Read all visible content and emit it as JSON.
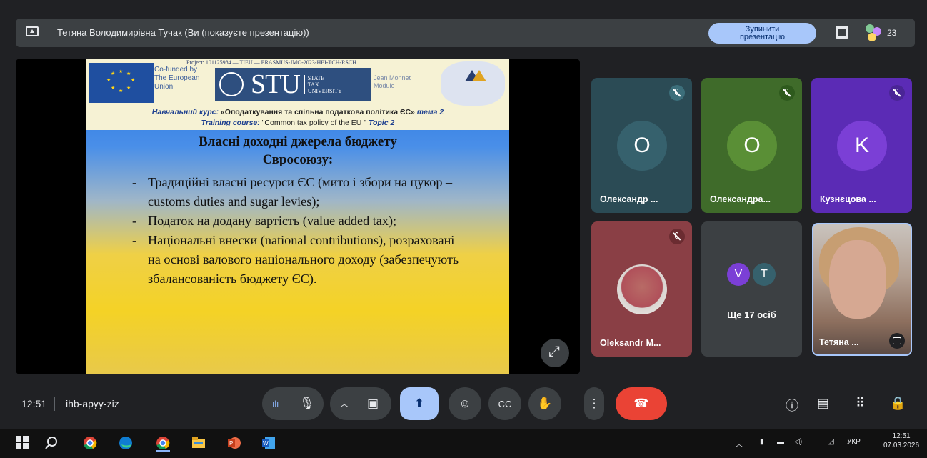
{
  "topbar": {
    "title": "Тетяна Володимирівна Тучак (Ви (показуєте презентацію))",
    "stop_button": "Зупинити презентацію",
    "participants_count": "23"
  },
  "slide": {
    "project_line": "Project: 101125984 — TIEU — ERASMUS-JMO-2023-HEI-TCH-RSCH",
    "cofunded": [
      "Co-funded by",
      "The European",
      "Union"
    ],
    "stu_letters": "STU",
    "stu_sub": [
      "STATE",
      "TAX",
      "UNIVERSITY"
    ],
    "jean": [
      "Jean Monnet",
      "Module"
    ],
    "course_ua_prefix": "Навчальний курс: ",
    "course_ua_bold": "«Оподаткування та спільна податкова політика ЄС»",
    "course_ua_topic": " тема 2",
    "course_en_prefix": "Training course: ",
    "course_en_name": "\"Common tax policy of the EU \"",
    "course_en_topic": " Topic 2",
    "title_line1": "Власні доходні джерела бюджету",
    "title_line2": "Євросоюзу:",
    "bullets": [
      "Традиційні власні ресурси ЄС (мито і збори на цукор – customs duties and sugar levies);",
      "Податок на додану вартість (value added tax);",
      "Національні внески (national contributions), розраховані на основі валового національного доходу (забезпечують збалансованість бюджету ЄС)."
    ]
  },
  "tiles": [
    {
      "initial": "O",
      "name": "Олександр ...",
      "bg": "#2b4b55",
      "avatar_bg": "#36616d"
    },
    {
      "initial": "O",
      "name": "Олександра...",
      "bg": "#3f6b2a",
      "avatar_bg": "#5a8f36"
    },
    {
      "initial": "K",
      "name": "Кузнєцова ...",
      "bg": "#5b2bb5",
      "avatar_bg": "#7b3fd6"
    },
    {
      "initial": "",
      "name": "Oleksandr M...",
      "bg": "#8a3f45",
      "avatar_bg": "#b0505a"
    },
    {
      "more_avatars": [
        "V",
        "T"
      ],
      "name": "Ще 17 осіб",
      "bg": "#3c4043"
    }
  ],
  "self_tile": {
    "name": "Тетяна ..."
  },
  "bottombar": {
    "time": "12:51",
    "meeting_code": "ihb-apyy-ziz"
  },
  "taskbar": {
    "lang": "УКР",
    "time": "12:51",
    "date": "07.03.2026"
  }
}
